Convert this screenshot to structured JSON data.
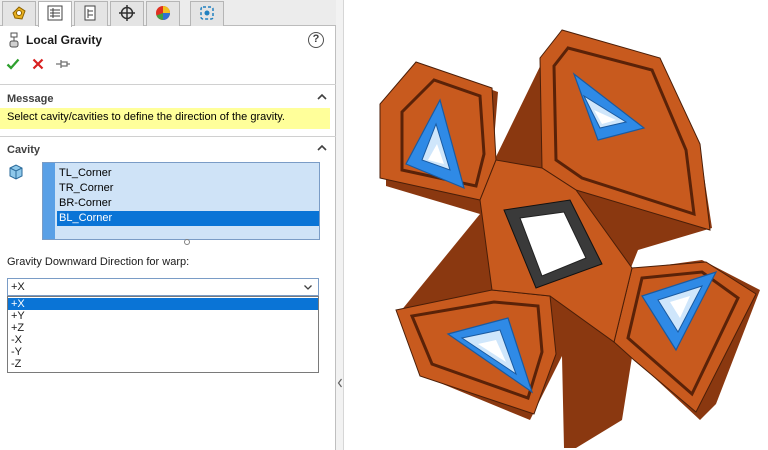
{
  "tabs": [
    {
      "name": "feature-manager-tab",
      "icon": "feature-manager-icon"
    },
    {
      "name": "property-manager-tab",
      "icon": "property-manager-icon",
      "active": true
    },
    {
      "name": "configuration-manager-tab",
      "icon": "configuration-manager-icon"
    },
    {
      "name": "dimxpert-manager-tab",
      "icon": "crosshair-icon"
    },
    {
      "name": "display-manager-tab",
      "icon": "pie-chart-icon"
    },
    {
      "name": "simulation-tab",
      "icon": "simulation-icon"
    }
  ],
  "header": {
    "title": "Local Gravity",
    "help_icon_glyph": "?"
  },
  "actions": {
    "ok_icon": "checkmark-icon",
    "cancel_icon": "x-icon",
    "pin_icon": "pushpin-icon"
  },
  "message": {
    "section_title": "Message",
    "text": "Select cavity/cavities to define the direction of the gravity."
  },
  "cavity": {
    "section_title": "Cavity",
    "items": [
      {
        "label": "TL_Corner",
        "selected": false
      },
      {
        "label": "TR_Corner",
        "selected": false
      },
      {
        "label": "BR-Corner",
        "selected": false
      },
      {
        "label": "BL_Corner",
        "selected": true
      }
    ]
  },
  "gravity": {
    "label": "Gravity Downward Direction for warp:",
    "selected": "+X",
    "options": [
      "+X",
      "+Y",
      "+Z",
      "-X",
      "-Y",
      "-Z"
    ]
  },
  "colors": {
    "part_orange": "#c85a1e",
    "part_dark": "#8a3810",
    "cavity_blue": "#2f8ae6",
    "selection_blue": "#0a74d6",
    "message_yellow": "#ffff9a"
  }
}
